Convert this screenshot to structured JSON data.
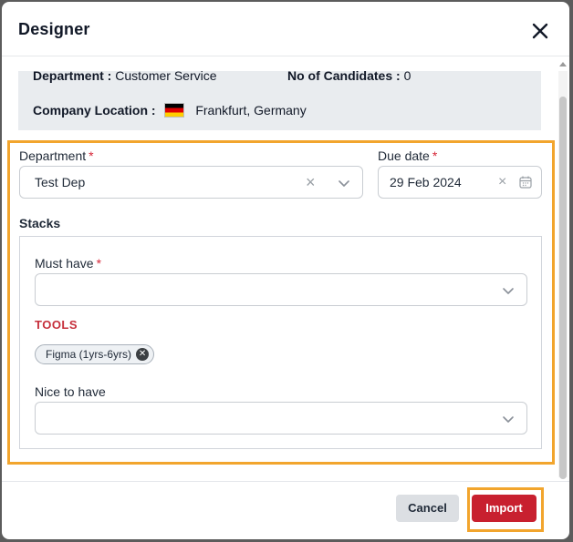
{
  "modal": {
    "title": "Designer"
  },
  "info": {
    "department_key": "Department :",
    "department_value": "Customer Service",
    "candidates_key": "No of Candidates :",
    "candidates_value": "0",
    "location_key": "Company Location :",
    "location_value": "Frankfurt, Germany"
  },
  "form": {
    "department_label": "Department",
    "department_value": "Test Dep",
    "due_date_label": "Due date",
    "due_date_value": "29 Feb 2024",
    "required_mark": "*",
    "stacks_title": "Stacks",
    "must_have_label": "Must have",
    "must_have_placeholder": "",
    "category": "TOOLS",
    "chips": [
      "Figma (1yrs-6yrs)"
    ],
    "nice_to_have_label": "Nice to have",
    "nice_to_have_placeholder": ""
  },
  "footer": {
    "cancel_label": "Cancel",
    "import_label": "Import"
  },
  "colors": {
    "accent_highlight": "#f2a52d",
    "primary_red": "#c8202f",
    "category_red": "#c62f3b",
    "required_red": "#d62839"
  }
}
